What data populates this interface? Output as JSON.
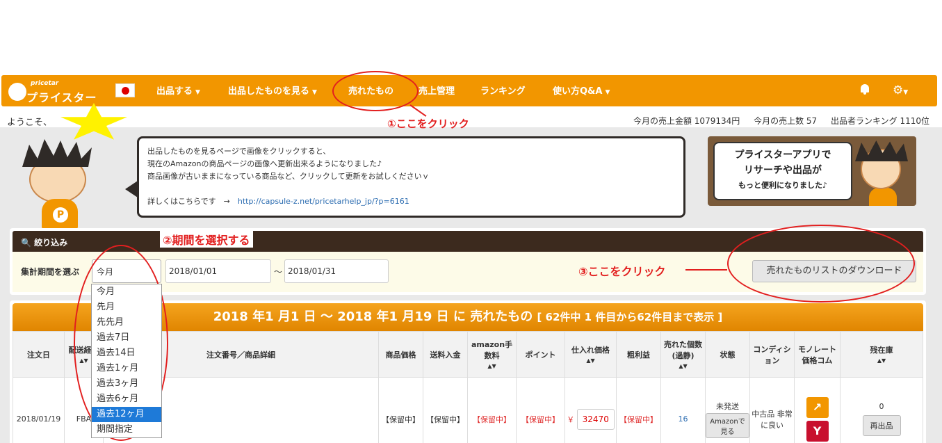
{
  "navbar": {
    "logo_small": "pricetar",
    "logo_big": "プライスター",
    "items": [
      {
        "label": "出品する"
      },
      {
        "label": "出品したものを見る"
      },
      {
        "label": "売れたもの"
      },
      {
        "label": "売上管理"
      },
      {
        "label": "ランキング"
      },
      {
        "label": "使い方Q&A"
      }
    ],
    "icons": [
      "bell-icon",
      "gear-icon"
    ]
  },
  "status_bar": {
    "welcome": "ようこそ、",
    "sales_amount": "今月の売上金額 1079134円",
    "sales_count": "今月の売上数 57",
    "ranking": "出品者ランキング 1110位"
  },
  "notice": {
    "line1": "出品したものを見るページで画像をクリックすると、",
    "line2": "現在のAmazonの商品ページの画像へ更新出来るようになりました♪",
    "line3": "商品画像が古いままになっている商品など、クリックして更新をお試しくださいｖ",
    "detail_label": "詳しくはこちらです　→",
    "detail_link": "http://capsule-z.net/pricetarhelp_jp/?p=6161"
  },
  "banner": {
    "line1": "プライスターアプリで",
    "line2": "リサーチや出品が",
    "line3": "もっと便利になりました♪"
  },
  "filter": {
    "title": "絞り込み",
    "period_label": "集計期間を選ぶ",
    "selected_period": "今月",
    "date_from": "2018/01/01",
    "tilde": "〜",
    "date_to": "2018/01/31",
    "download_button": "売れたものリストのダウンロード",
    "options": [
      "今月",
      "先月",
      "先先月",
      "過去7日",
      "過去14日",
      "過去1ヶ月",
      "過去3ヶ月",
      "過去6ヶ月",
      "過去12ヶ月",
      "期間指定"
    ],
    "highlighted_option": "過去12ヶ月"
  },
  "results": {
    "title_main": "2018 年1 月1 日 〜 2018 年1 月19 日 に 売れたもの",
    "title_sub": "[ 62件中 1 件目から62件目まで表示 ]",
    "columns": [
      "注文日",
      "配送経路",
      "注文番号／商品詳細",
      "商品価格",
      "送料入金",
      "amazon手数料",
      "ポイント",
      "仕入れ価格",
      "粗利益",
      "売れた個数(過静)",
      "状態",
      "コンディション",
      "モノレート価格コム",
      "残在庫"
    ],
    "row": {
      "date": "2018/01/19",
      "route": "FBA",
      "price": "【保留中】",
      "shipping": "【保留中】",
      "fee": "【保留中】",
      "point": "【保留中】",
      "cost_prefix": "￥",
      "cost": "32470",
      "profit": "【保留中】",
      "sold": "16",
      "status": "未発送",
      "status_button": "Amazonで見る",
      "condition": "中古品 非常に良い",
      "stock": "0",
      "relist_button": "再出品"
    }
  },
  "annotations": {
    "step1": "①ここをクリック",
    "step2": "②期間を選択する",
    "step3": "③ここをクリック"
  },
  "colors": {
    "navbar": "#f29600",
    "filter_header": "#3c2a1e",
    "annotation": "#e21f1f",
    "dropdown_selected": "#1e7ad8"
  }
}
